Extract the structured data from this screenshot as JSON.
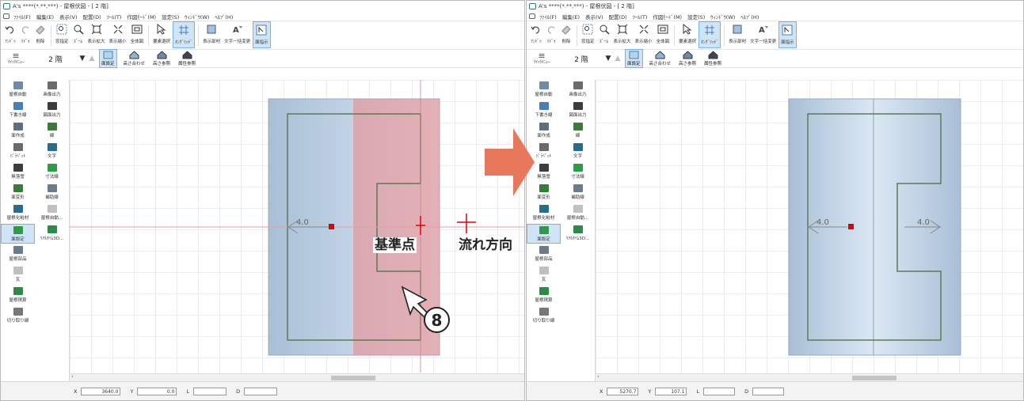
{
  "window": {
    "title": "A's ****(*.**.***) - 屋根伏図 - [ 2 階]"
  },
  "menu": [
    "ﾌｧｲﾙ(F)",
    "編集(E)",
    "表示(V)",
    "配置(D)",
    "ﾂｰﾙ(T)",
    "作図ﾓｰﾄﾞ(M)",
    "設定(S)",
    "ｳｨﾝﾄﾞｳ(W)",
    "ﾍﾙﾌﾟ(H)"
  ],
  "toolbar": {
    "undo": "ｱﾝﾄﾞｩ",
    "redo": "ﾘﾄﾞｩ",
    "delete": "削除",
    "window_zoom": "窓指定",
    "zoom": "ｽﾞｰﾑ",
    "zoom_in": "表示拡大",
    "zoom_out": "表示縮小",
    "fit_all": "全体図",
    "select": "要素選択",
    "on_grid": "ｵﾝｸﾞﾘｯﾄﾞ",
    "show_parts": "表示部材",
    "text_replace": "文字一括変更",
    "plane_display": "面指示"
  },
  "subbar": {
    "quick_menu": "ｸｲｯｸﾒﾆｭｰ",
    "floor": "2 階",
    "face_setting": "面設定",
    "height_align": "高さ合わせ",
    "height_ref": "高さ参照",
    "attr_ref": "属性参照"
  },
  "left_panel": [
    [
      "屋根自動",
      "画像出力"
    ],
    [
      "下書き線",
      "図面出力"
    ],
    [
      "面作成",
      "線"
    ],
    [
      "ﾊﾟﾗﾍﾟｯﾄ",
      "文字"
    ],
    [
      "無落雪",
      "寸法線"
    ],
    [
      "面変形",
      "補助線"
    ],
    [
      "屋根化粧材",
      "屋根自動..."
    ],
    [
      "面設定",
      "ﾘｱﾙﾀｲﾑ3D..."
    ],
    [
      "屋根部品"
    ],
    [
      "瓦"
    ],
    [
      "屋根積算"
    ],
    [
      "切り取り線"
    ]
  ],
  "canvas_left": {
    "slope_label_left": "4.0",
    "label_base_point": "基準点",
    "label_flow_dir": "流れ方向",
    "step_number": "8"
  },
  "canvas_right": {
    "slope_label_left": "4.0",
    "slope_label_right": "4.0"
  },
  "status_left": {
    "x_label": "X",
    "x_value": "3640.0",
    "y_label": "Y",
    "y_value": "0.0",
    "l_label": "L",
    "d_label": "D"
  },
  "status_right": {
    "x_label": "X",
    "x_value": "5270.7",
    "y_label": "Y",
    "y_value": "107.1",
    "l_label": "L",
    "d_label": "D"
  },
  "colors": {
    "roof_fill": "#c3d4e6",
    "highlight": "#e88e92",
    "arrow": "#e8785b",
    "outline": "#5c7a56",
    "marker": "#e00000"
  }
}
